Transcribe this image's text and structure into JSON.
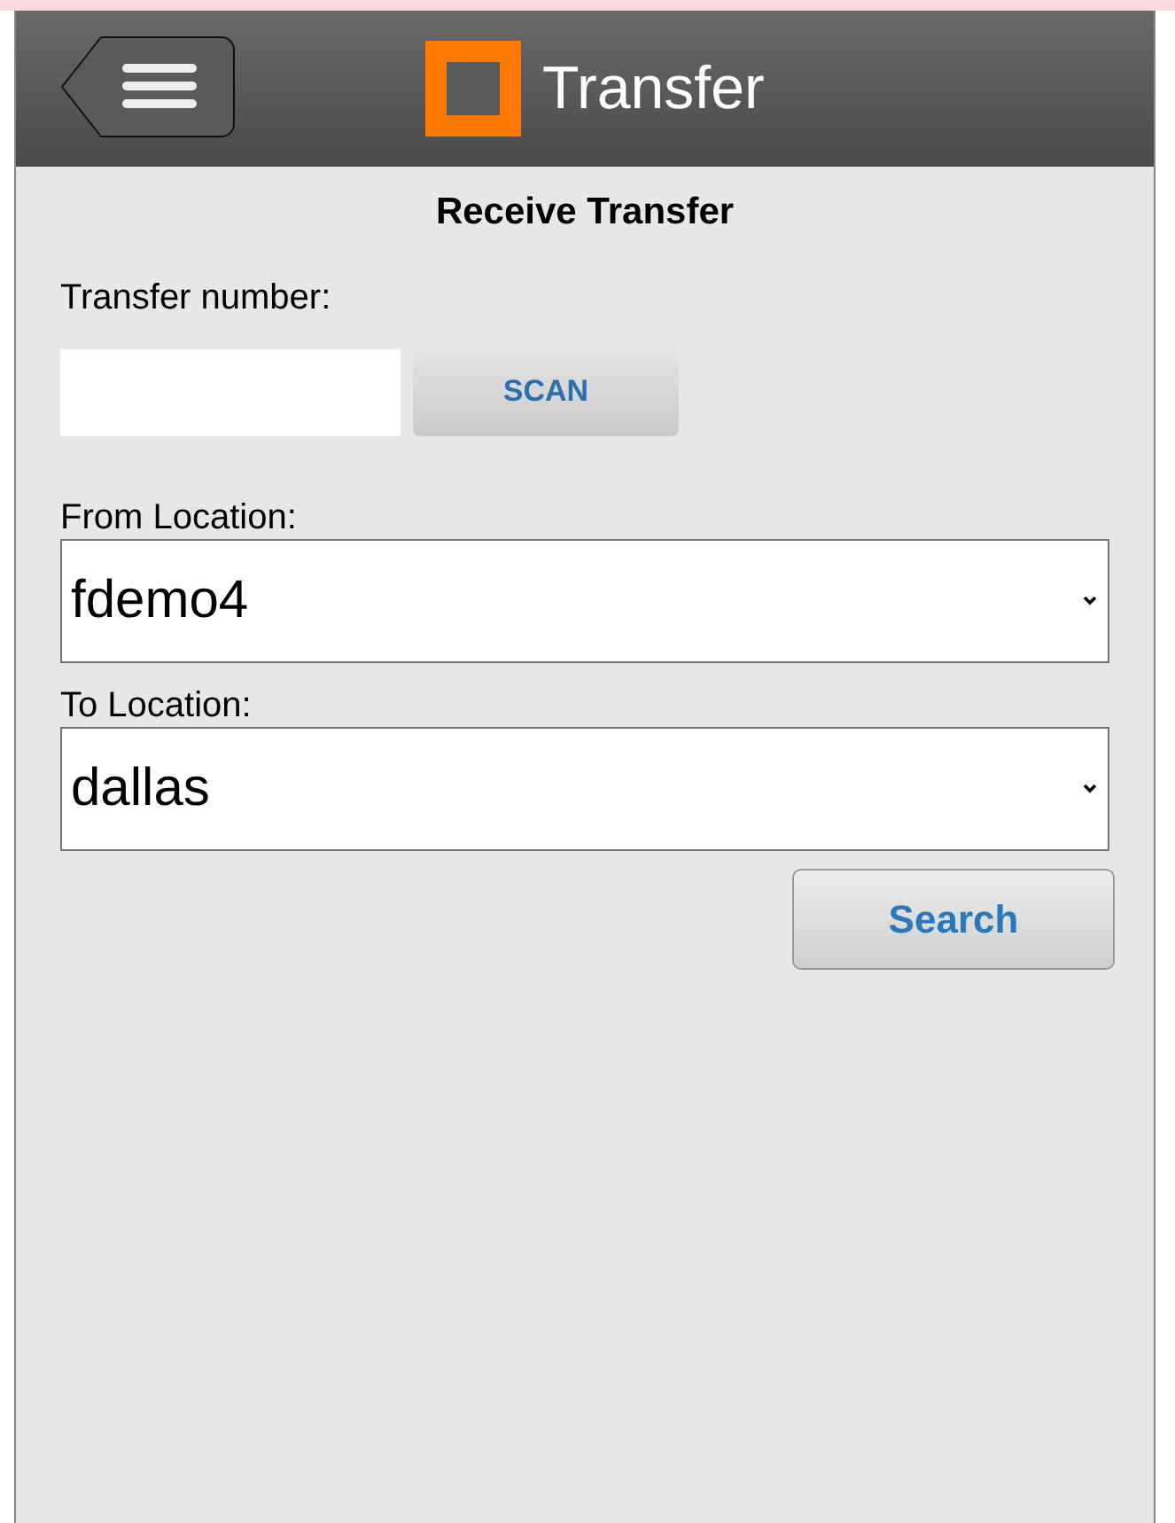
{
  "header": {
    "title": "Transfer"
  },
  "form": {
    "heading": "Receive Transfer",
    "transfer_number": {
      "label": "Transfer number:",
      "scan_button": "SCAN"
    },
    "from_location": {
      "label": "From Location:",
      "value": "fdemo4"
    },
    "to_location": {
      "label": "To Location:",
      "value": "dallas"
    },
    "search_button": "Search"
  }
}
